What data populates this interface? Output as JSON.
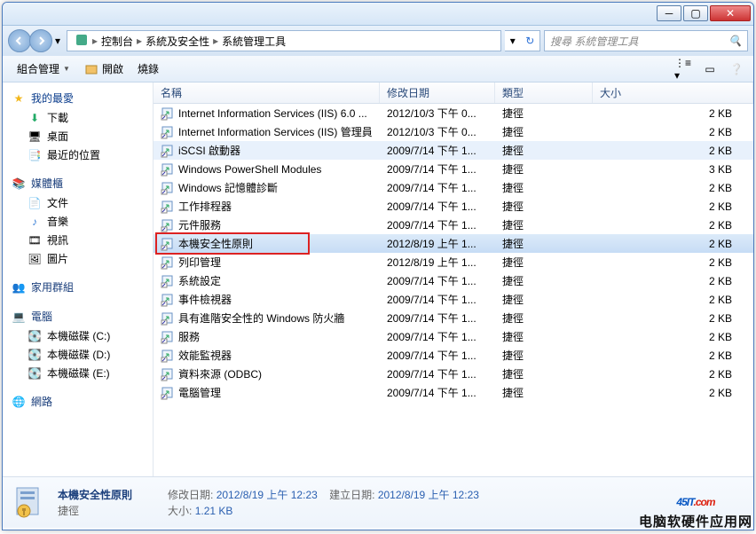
{
  "breadcrumb": {
    "root_icon": "▰",
    "seg1": "控制台",
    "seg2": "系統及安全性",
    "seg3": "系統管理工具"
  },
  "search": {
    "placeholder": "搜尋 系統管理工具"
  },
  "toolbar": {
    "org": "組合管理",
    "open": "開啟",
    "burn": "燒錄"
  },
  "nav": {
    "favorites": "我的最愛",
    "favitems": [
      "下載",
      "桌面",
      "最近的位置"
    ],
    "libraries": "媒體櫃",
    "libitems": [
      "文件",
      "音樂",
      "視訊",
      "圖片"
    ],
    "homegroup": "家用群組",
    "computer": "電腦",
    "drives": [
      "本機磁碟 (C:)",
      "本機磁碟 (D:)",
      "本機磁碟 (E:)"
    ],
    "network": "網路"
  },
  "columns": {
    "name": "名稱",
    "date": "修改日期",
    "type": "類型",
    "size": "大小"
  },
  "rows": [
    {
      "name": "Internet Information Services (IIS) 6.0 ...",
      "date": "2012/10/3 下午 0...",
      "type": "捷徑",
      "size": "2 KB",
      "sel": false,
      "hover": false
    },
    {
      "name": "Internet Information Services (IIS) 管理員",
      "date": "2012/10/3 下午 0...",
      "type": "捷徑",
      "size": "2 KB",
      "sel": false,
      "hover": false
    },
    {
      "name": "iSCSI 啟動器",
      "date": "2009/7/14 下午 1...",
      "type": "捷徑",
      "size": "2 KB",
      "sel": false,
      "hover": true
    },
    {
      "name": "Windows PowerShell Modules",
      "date": "2009/7/14 下午 1...",
      "type": "捷徑",
      "size": "3 KB",
      "sel": false,
      "hover": false
    },
    {
      "name": "Windows 記憶體診斷",
      "date": "2009/7/14 下午 1...",
      "type": "捷徑",
      "size": "2 KB",
      "sel": false,
      "hover": false
    },
    {
      "name": "工作排程器",
      "date": "2009/7/14 下午 1...",
      "type": "捷徑",
      "size": "2 KB",
      "sel": false,
      "hover": false
    },
    {
      "name": "元件服務",
      "date": "2009/7/14 下午 1...",
      "type": "捷徑",
      "size": "2 KB",
      "sel": false,
      "hover": false
    },
    {
      "name": "本機安全性原則",
      "date": "2012/8/19 上午 1...",
      "type": "捷徑",
      "size": "2 KB",
      "sel": true,
      "hover": false,
      "hl": true
    },
    {
      "name": "列印管理",
      "date": "2012/8/19 上午 1...",
      "type": "捷徑",
      "size": "2 KB",
      "sel": false,
      "hover": false
    },
    {
      "name": "系統設定",
      "date": "2009/7/14 下午 1...",
      "type": "捷徑",
      "size": "2 KB",
      "sel": false,
      "hover": false
    },
    {
      "name": "事件檢視器",
      "date": "2009/7/14 下午 1...",
      "type": "捷徑",
      "size": "2 KB",
      "sel": false,
      "hover": false
    },
    {
      "name": "具有進階安全性的 Windows 防火牆",
      "date": "2009/7/14 下午 1...",
      "type": "捷徑",
      "size": "2 KB",
      "sel": false,
      "hover": false
    },
    {
      "name": "服務",
      "date": "2009/7/14 下午 1...",
      "type": "捷徑",
      "size": "2 KB",
      "sel": false,
      "hover": false
    },
    {
      "name": "效能監視器",
      "date": "2009/7/14 下午 1...",
      "type": "捷徑",
      "size": "2 KB",
      "sel": false,
      "hover": false
    },
    {
      "name": "資料來源 (ODBC)",
      "date": "2009/7/14 下午 1...",
      "type": "捷徑",
      "size": "2 KB",
      "sel": false,
      "hover": false
    },
    {
      "name": "電腦管理",
      "date": "2009/7/14 下午 1...",
      "type": "捷徑",
      "size": "2 KB",
      "sel": false,
      "hover": false
    }
  ],
  "details": {
    "title": "本機安全性原則",
    "subtitle": "捷徑",
    "mod_label": "修改日期:",
    "mod_val": "2012/8/19 上午 12:23",
    "size_label": "大小:",
    "size_val": "1.21 KB",
    "created_label": "建立日期:",
    "created_val": "2012/8/19 上午 12:23"
  },
  "watermark": {
    "logo1": "45",
    "logo2": "IT",
    "logo3": ".com",
    "sub": "电脑软硬件应用网"
  }
}
